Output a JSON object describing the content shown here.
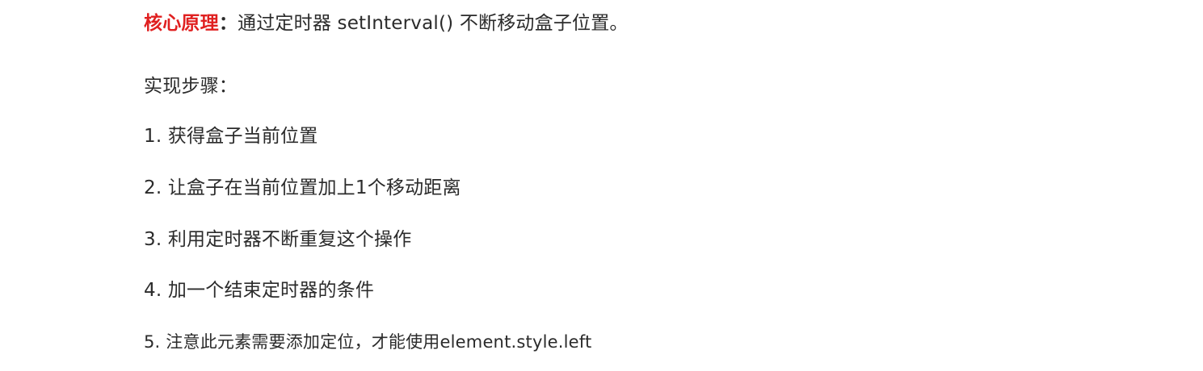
{
  "colors": {
    "accent": "#e02020",
    "text": "#2b2b2b"
  },
  "principle": {
    "label": "核心原理",
    "colon": "：",
    "text": "通过定时器 setInterval() 不断移动盒子位置。"
  },
  "steps_heading": "实现步骤：",
  "steps": [
    "1. 获得盒子当前位置",
    "2. 让盒子在当前位置加上1个移动距离",
    "3. 利用定时器不断重复这个操作",
    "4. 加一个结束定时器的条件",
    "5. 注意此元素需要添加定位，才能使用element.style.left"
  ]
}
